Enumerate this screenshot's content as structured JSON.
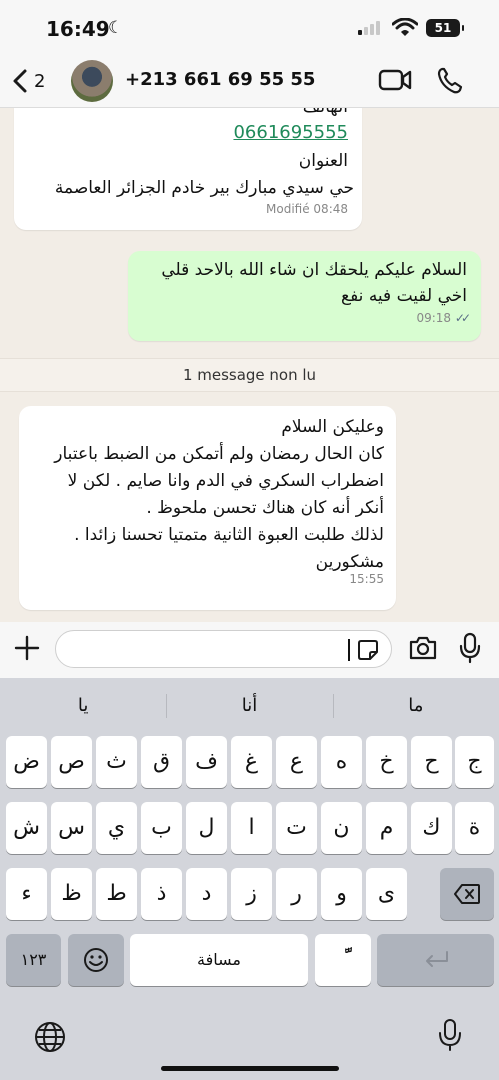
{
  "status": {
    "time": "16:49",
    "battery": "51"
  },
  "header": {
    "back_count": "2",
    "contact": "+213 661 69 55 55"
  },
  "messages": [
    {
      "lines": [
        "الهاتف",
        "0661695555",
        "العنوان",
        "حي سيدي مبارك بير خادم الجزائر العاصمة"
      ],
      "meta": "Modifié 08:48"
    },
    {
      "lines": [
        "السلام عليكم يلحقك ان شاء الله بالاحد قلي",
        "اخي لقيت فيه نفع"
      ],
      "meta": "09:18"
    },
    {
      "lines": [
        "وعليكن السلام",
        "كان الحال رمضان ولم أتمكن من الضبط  باعتبار",
        "اضطراب السكري في الدم وانا صايم . لكن لا",
        "أنكر أنه كان هناك تحسن ملحوظ .",
        "لذلك طلبت العبوة الثانية متمتيا تحسنا زائدا .",
        "مشكورين"
      ],
      "meta": "15:55"
    }
  ],
  "unread_banner": "1 message non lu",
  "input": {
    "placeholder": ""
  },
  "keyboard": {
    "suggestions": [
      "يا",
      "أنا",
      "ما"
    ],
    "row1": [
      "ض",
      "ص",
      "ث",
      "ق",
      "ف",
      "غ",
      "ع",
      "ه",
      "خ",
      "ح",
      "ج"
    ],
    "row2": [
      "ش",
      "س",
      "ي",
      "ب",
      "ل",
      "ا",
      "ت",
      "ن",
      "م",
      "ك",
      "ة"
    ],
    "row3": [
      "ء",
      "ظ",
      "ط",
      "ذ",
      "د",
      "ز",
      "ر",
      "و",
      "ى"
    ],
    "numbers_key": "١٢٣",
    "space_key": "مسافة",
    "diacritic_key": "ًّ"
  }
}
